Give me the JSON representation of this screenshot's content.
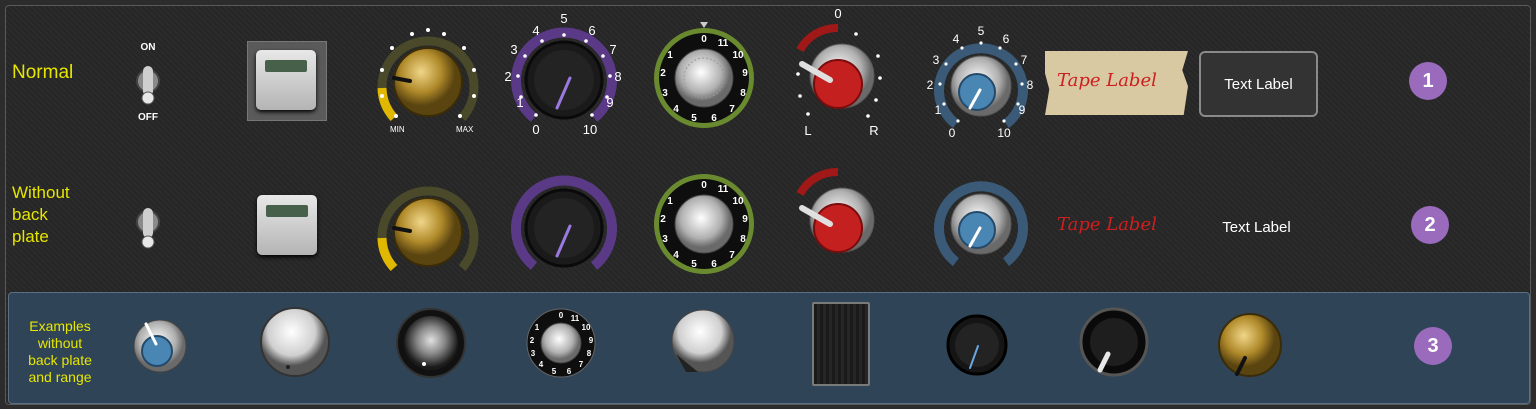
{
  "rows": {
    "row1": {
      "label": "Normal",
      "badge": "1"
    },
    "row2": {
      "label_lines": [
        "Without",
        "back",
        "plate"
      ],
      "badge": "2"
    },
    "row3": {
      "label_lines": [
        "Examples",
        "without",
        "back plate",
        "and range"
      ],
      "badge": "3"
    }
  },
  "toggle": {
    "on_label": "ON",
    "off_label": "OFF"
  },
  "gold_knob": {
    "min_label": "MIN",
    "max_label": "MAX",
    "value_fraction": 0.3
  },
  "purple_knob": {
    "scale": [
      "0",
      "1",
      "2",
      "3",
      "4",
      "5",
      "6",
      "7",
      "8",
      "9",
      "10"
    ],
    "value": 1.5
  },
  "green_knob": {
    "dial_numbers": [
      "0",
      "11",
      "10",
      "9",
      "8",
      "7",
      "6",
      "5",
      "4",
      "3",
      "2",
      "1"
    ]
  },
  "pan_knob": {
    "top_label": "0",
    "left_label": "L",
    "right_label": "R"
  },
  "blue_knob": {
    "scale": [
      "0",
      "1",
      "2",
      "3",
      "4",
      "5",
      "6",
      "7",
      "8",
      "9",
      "10"
    ]
  },
  "tape_label": {
    "text": "Tape Label"
  },
  "text_label": {
    "text": "Text Label"
  },
  "colors": {
    "row_label": "#e6e600",
    "badge": "#9a6bbd",
    "gold": "#e0b800",
    "purple": "#5a3a86",
    "green": "#6a8a30",
    "red": "#b01818",
    "blue": "#3a5a78",
    "row3_background": "#2f4456"
  }
}
